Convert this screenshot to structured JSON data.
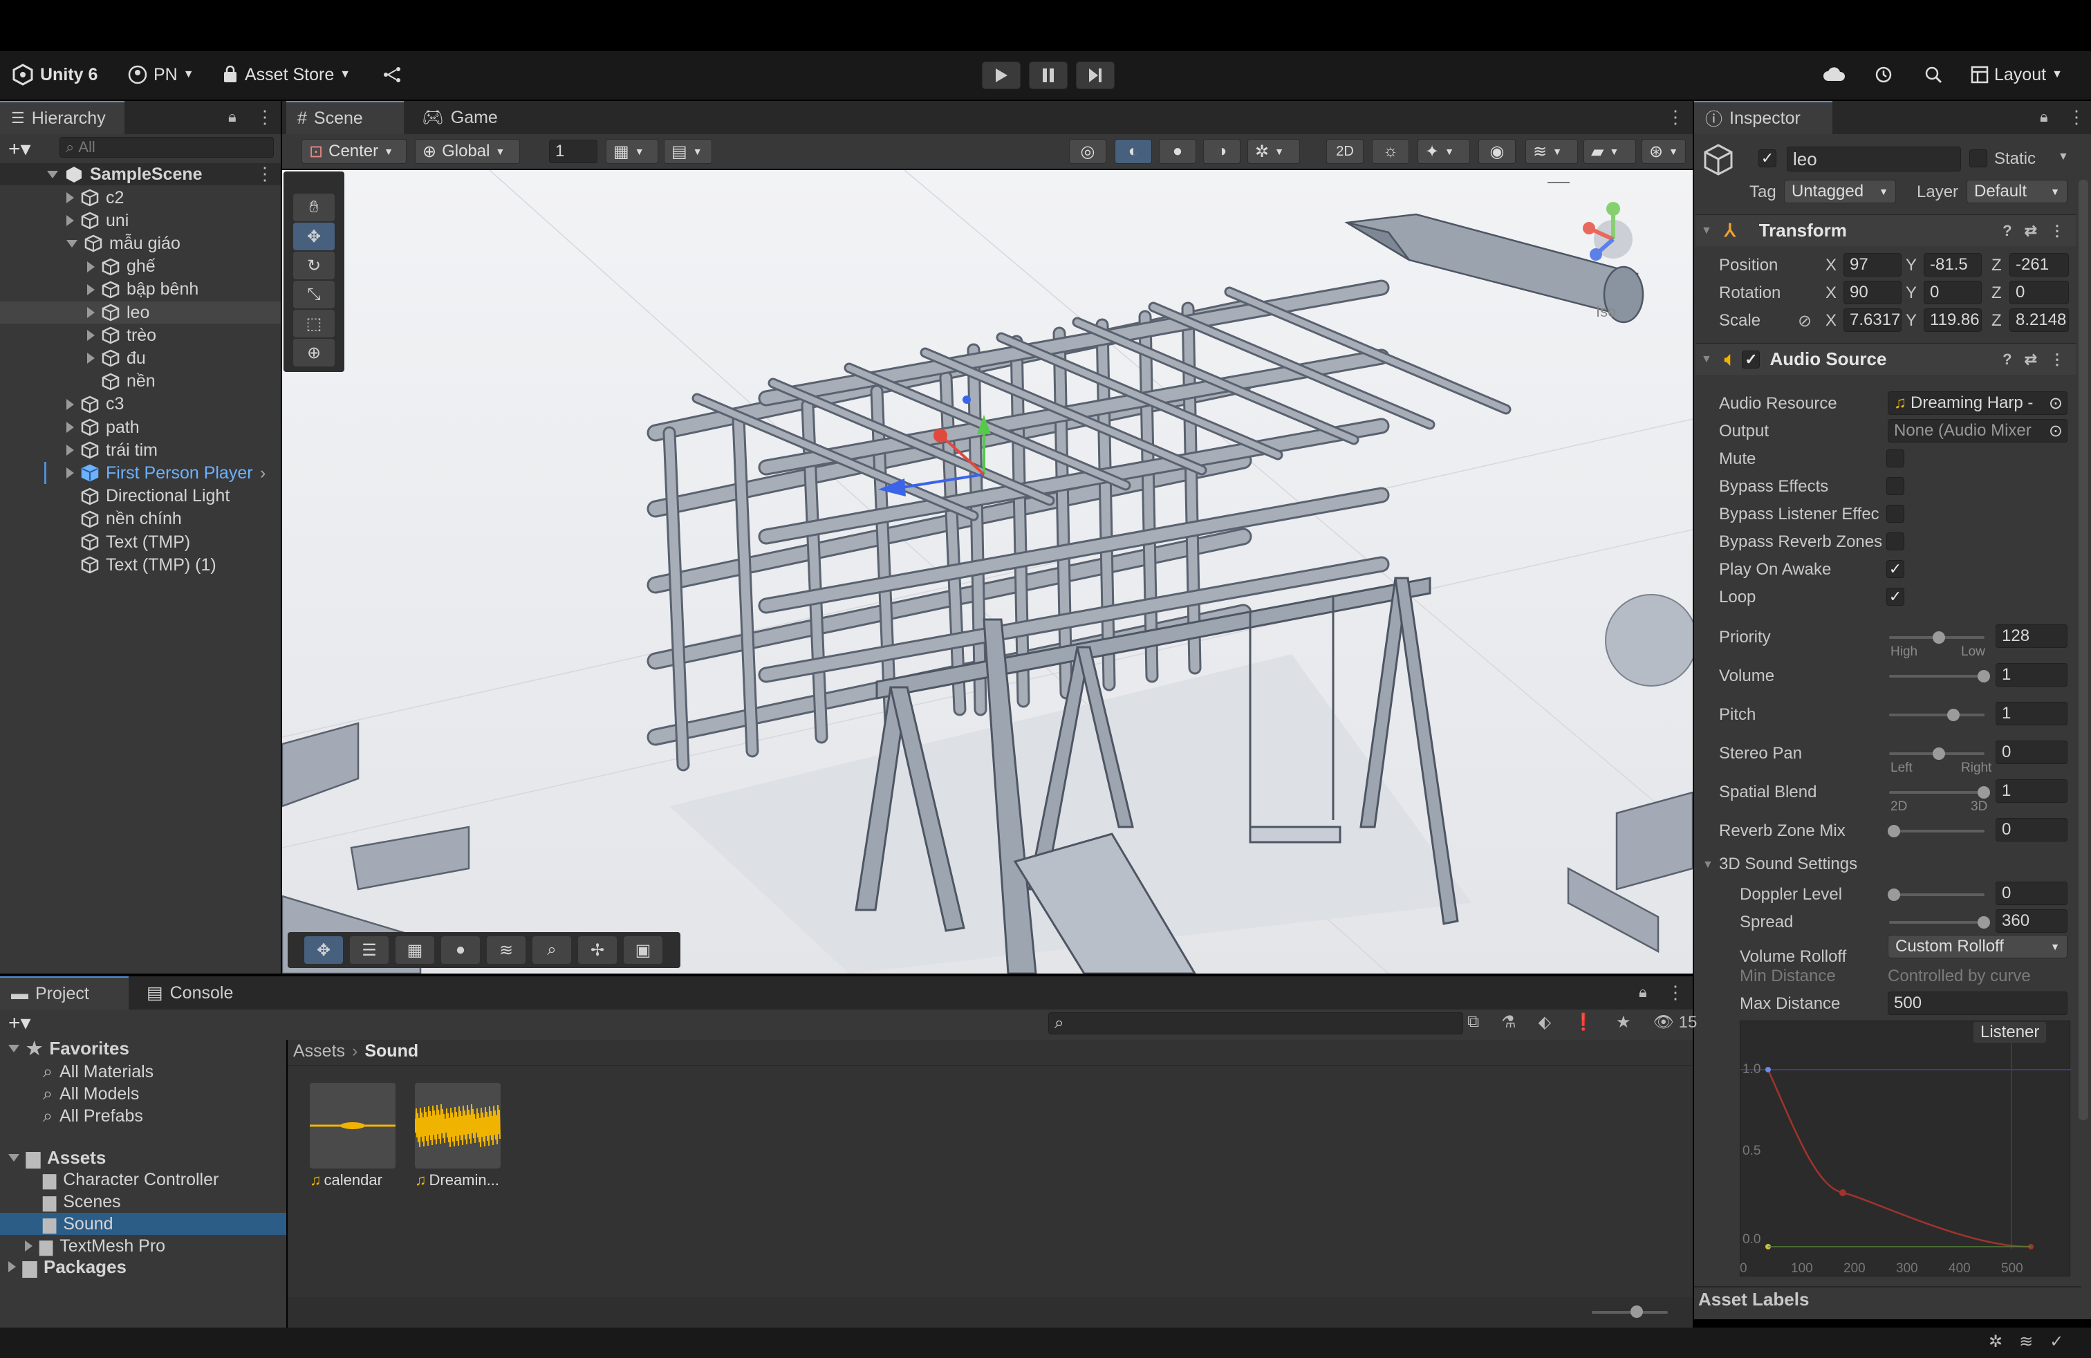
{
  "toolbar": {
    "unity_label": "Unity 6",
    "account_label": "PN",
    "asset_store_label": "Asset Store",
    "layout_label": "Layout"
  },
  "hierarchy": {
    "tab_label": "Hierarchy",
    "search_placeholder": "All",
    "scene_name": "SampleScene",
    "items": [
      {
        "label": "c2"
      },
      {
        "label": "uni"
      },
      {
        "label": "mẫu giáo"
      },
      {
        "label": "ghế"
      },
      {
        "label": "bập bênh"
      },
      {
        "label": "leo"
      },
      {
        "label": "trèo"
      },
      {
        "label": "đu"
      },
      {
        "label": "nền"
      },
      {
        "label": "c3"
      },
      {
        "label": "path"
      },
      {
        "label": "trái tim"
      },
      {
        "label": "First Person Player"
      },
      {
        "label": "Directional Light"
      },
      {
        "label": "nền chính"
      },
      {
        "label": "Text (TMP)"
      },
      {
        "label": "Text (TMP) (1)"
      }
    ]
  },
  "scene": {
    "tab_scene": "Scene",
    "tab_game": "Game",
    "pivot_label": "Center",
    "space_label": "Global",
    "snap_value": "1",
    "iso_label": "Iso"
  },
  "inspector": {
    "tab_label": "Inspector",
    "object_name": "leo",
    "static_label": "Static",
    "tag_label": "Tag",
    "tag_value": "Untagged",
    "layer_label": "Layer",
    "layer_value": "Default",
    "transform": {
      "title": "Transform",
      "position_label": "Position",
      "rotation_label": "Rotation",
      "scale_label": "Scale",
      "position": {
        "x": "97",
        "y": "-81.5",
        "z": "-261"
      },
      "rotation": {
        "x": "90",
        "y": "0",
        "z": "0"
      },
      "scale": {
        "x": "7.6317",
        "y": "119.86",
        "z": "8.2148"
      }
    },
    "audio": {
      "title": "Audio Source",
      "resource_label": "Audio Resource",
      "resource_value": "Dreaming Harp -",
      "output_label": "Output",
      "output_value": "None (Audio Mixer",
      "mute_label": "Mute",
      "bypass_effects_label": "Bypass Effects",
      "bypass_listener_label": "Bypass Listener Effec",
      "bypass_reverb_label": "Bypass Reverb Zones",
      "play_on_awake_label": "Play On Awake",
      "loop_label": "Loop",
      "priority_label": "Priority",
      "priority_value": "128",
      "priority_high": "High",
      "priority_low": "Low",
      "volume_label": "Volume",
      "volume_value": "1",
      "pitch_label": "Pitch",
      "pitch_value": "1",
      "stereo_label": "Stereo Pan",
      "stereo_value": "0",
      "stereo_left": "Left",
      "stereo_right": "Right",
      "spatial_label": "Spatial Blend",
      "spatial_value": "1",
      "spatial_2d": "2D",
      "spatial_3d": "3D",
      "reverb_mix_label": "Reverb Zone Mix",
      "reverb_mix_value": "0",
      "sound3d_label": "3D Sound Settings",
      "doppler_label": "Doppler Level",
      "doppler_value": "0",
      "spread_label": "Spread",
      "spread_value": "360",
      "rolloff_label": "Volume Rolloff",
      "rolloff_value": "Custom Rolloff",
      "min_dist_label": "Min Distance",
      "min_dist_value": "Controlled by curve",
      "max_dist_label": "Max Distance",
      "max_dist_value": "500",
      "listener_label": "Listener"
    },
    "curve": {
      "y_ticks": [
        "1.0",
        "0.5",
        "0.0"
      ],
      "x_ticks": [
        "0",
        "100",
        "200",
        "300",
        "400",
        "500"
      ]
    },
    "asset_labels": "Asset Labels"
  },
  "project": {
    "tab_project": "Project",
    "tab_console": "Console",
    "hidden_count": "15",
    "favorites_label": "Favorites",
    "favorites": [
      "All Materials",
      "All Models",
      "All Prefabs"
    ],
    "assets_label": "Assets",
    "asset_folders": [
      "Character Controller",
      "Scenes",
      "Sound",
      "TextMesh Pro"
    ],
    "packages_label": "Packages",
    "breadcrumb_root": "Assets",
    "breadcrumb_current": "Sound",
    "files": [
      {
        "label": "calendar"
      },
      {
        "label": "Dreamin..."
      }
    ]
  },
  "colors": {
    "accent": "#4e8fda",
    "selection": "#2c5d87",
    "audio_wave": "#f0b400",
    "prefab_blue": "#6bb2ff"
  }
}
